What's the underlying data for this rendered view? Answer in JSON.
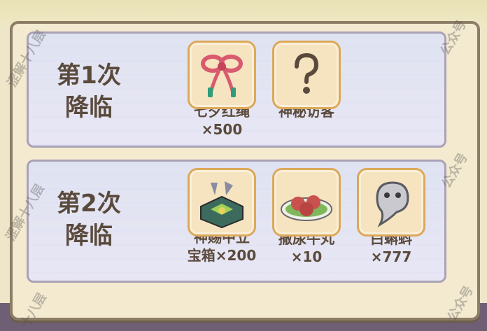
{
  "rounds": [
    {
      "title": "第1次降临",
      "title_line1": "第1次",
      "title_line2": "降临",
      "items": [
        {
          "icon": "red-rope-icon",
          "name": "七夕红绳",
          "qty": "×500"
        },
        {
          "icon": "question-mark-icon",
          "name": "神秘访客",
          "qty": ""
        }
      ]
    },
    {
      "title": "第2次降临",
      "title_line1": "第2次",
      "title_line2": "降临",
      "items": [
        {
          "icon": "treasure-chest-icon",
          "name": "神赐中立",
          "name2": "宝箱",
          "qty": "×200"
        },
        {
          "icon": "meatball-plate-icon",
          "name": "撒尿牛丸",
          "qty": "×10"
        },
        {
          "icon": "tadpole-icon",
          "name": "白蝌蚪",
          "qty": "×777"
        }
      ]
    }
  ],
  "watermark": {
    "left_top": "涩解十八层",
    "left_mid": "涩解十八层",
    "left_bottom": "十八层",
    "right_top": "公众号",
    "right_mid": "公众号",
    "right_bottom": "公众号"
  },
  "colors": {
    "panel_border": "#8c7d66",
    "item_border": "#dca95a",
    "text": "#5a4a3c"
  }
}
